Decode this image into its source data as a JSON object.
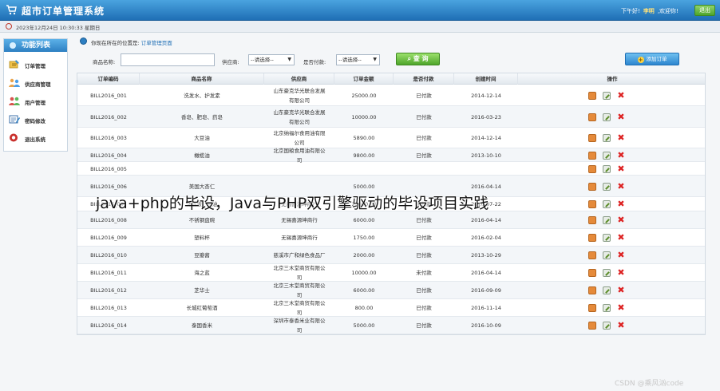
{
  "header": {
    "app_title": "超市订单管理系统",
    "greeting_prefix": "下午好!",
    "user_name": "李明",
    "greeting_suffix": ",欢迎你!",
    "logout_label": "退出"
  },
  "datebar": {
    "date_text": "2023年12月24日 10:30:33 星期日"
  },
  "sidebar": {
    "title": "功能列表",
    "items": [
      {
        "label": "订单管理",
        "icon": "order-icon"
      },
      {
        "label": "供应商管理",
        "icon": "supplier-icon"
      },
      {
        "label": "用户管理",
        "icon": "users-icon"
      },
      {
        "label": "密码修改",
        "icon": "password-icon"
      },
      {
        "label": "退出系统",
        "icon": "exit-icon"
      }
    ]
  },
  "location": {
    "prefix": "你现在所在的位置是:",
    "page": "订单管理页面"
  },
  "search": {
    "product_label": "商品名称:",
    "product_value": "",
    "supplier_label": "供应商:",
    "supplier_selected": "--请选择--",
    "paid_label": "是否付款:",
    "paid_selected": "--请选择--",
    "query_label": "查 询",
    "add_label": "添加订单"
  },
  "table": {
    "headers": [
      "订单编码",
      "商品名称",
      "供应商",
      "订单金额",
      "是否付款",
      "创建时间",
      "操作"
    ],
    "rows": [
      {
        "code": "BILL2016_001",
        "name": "洗发水、护发素",
        "supplier": "山东豪克华光联合发展有限公司",
        "amount": "25000.00",
        "paid": "已付款",
        "date": "2014-12-14"
      },
      {
        "code": "BILL2016_002",
        "name": "香皂、肥皂、药皂",
        "supplier": "山东豪克华光联合发展有限公司",
        "amount": "10000.00",
        "paid": "已付款",
        "date": "2016-03-23"
      },
      {
        "code": "BILL2016_003",
        "name": "大豆油",
        "supplier": "北京纳福尔食用油有限公司",
        "amount": "5890.00",
        "paid": "已付款",
        "date": "2014-12-14"
      },
      {
        "code": "BILL2016_004",
        "name": "橄榄油",
        "supplier": "北京国粮食用油有限公司",
        "amount": "9800.00",
        "paid": "已付款",
        "date": "2013-10-10"
      },
      {
        "code": "BILL2016_005",
        "name": "",
        "supplier": "",
        "amount": "",
        "paid": "",
        "date": ""
      },
      {
        "code": "BILL2016_006",
        "name": "美国大杏仁",
        "supplier": "",
        "amount": "5000.00",
        "paid": "",
        "date": "2016-04-14"
      },
      {
        "code": "BILL2016_007",
        "name": "沐浴液、精油",
        "supplier": "无锡喜源坤商行",
        "amount": "23000.00",
        "paid": "未付款",
        "date": "2016-07-22"
      },
      {
        "code": "BILL2016_008",
        "name": "不锈钢盘碗",
        "supplier": "无锡喜源坤商行",
        "amount": "6000.00",
        "paid": "已付款",
        "date": "2016-04-14"
      },
      {
        "code": "BILL2016_009",
        "name": "塑料杯",
        "supplier": "无锡喜源坤商行",
        "amount": "1750.00",
        "paid": "已付款",
        "date": "2016-02-04"
      },
      {
        "code": "BILL2016_010",
        "name": "豆瓣酱",
        "supplier": "慈溪市广和绿色食品厂",
        "amount": "2000.00",
        "paid": "已付款",
        "date": "2013-10-29"
      },
      {
        "code": "BILL2016_011",
        "name": "海之蓝",
        "supplier": "北京三木堂商贸有限公司",
        "amount": "10000.00",
        "paid": "未付款",
        "date": "2016-04-14"
      },
      {
        "code": "BILL2016_012",
        "name": "芝华士",
        "supplier": "北京三木堂商贸有限公司",
        "amount": "6000.00",
        "paid": "已付款",
        "date": "2016-09-09"
      },
      {
        "code": "BILL2016_013",
        "name": "长城红葡萄酒",
        "supplier": "北京三木堂商贸有限公司",
        "amount": "800.00",
        "paid": "已付款",
        "date": "2016-11-14"
      },
      {
        "code": "BILL2016_014",
        "name": "泰国香米",
        "supplier": "深圳市泰香米业有限公司",
        "amount": "5000.00",
        "paid": "已付款",
        "date": "2016-10-09"
      }
    ]
  },
  "overlay": {
    "caption": "java+php的毕设，Java与PHP双引擎驱动的毕设项目实践",
    "credit": "CSDN @乘风汹code"
  },
  "colors": {
    "header_blue": "#1f6fb5",
    "accent_green": "#4ea52b",
    "delete_red": "#dd2222",
    "view_orange": "#e58a3a"
  }
}
